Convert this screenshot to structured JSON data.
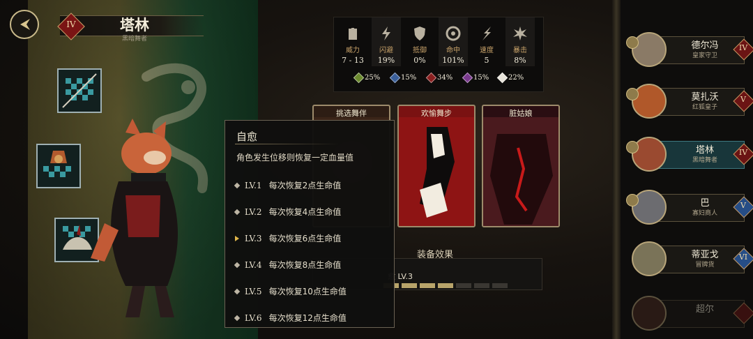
{
  "hero": {
    "name": "塔林",
    "title": "黑暗舞者",
    "rank": "IV"
  },
  "stats": [
    {
      "icon": "fist-icon",
      "label": "威力",
      "value": "7 - 13"
    },
    {
      "icon": "lightning-icon",
      "label": "闪避",
      "value": "19%"
    },
    {
      "icon": "shield-icon",
      "label": "抵御",
      "value": "0%"
    },
    {
      "icon": "target-icon",
      "label": "命中",
      "value": "101%"
    },
    {
      "icon": "speed-icon",
      "label": "速度",
      "value": "5"
    },
    {
      "icon": "crit-icon",
      "label": "暴击",
      "value": "8%"
    }
  ],
  "resistances": [
    {
      "color": "#6b8a2e",
      "value": "25%"
    },
    {
      "color": "#3a5f9a",
      "value": "15%"
    },
    {
      "color": "#8a1f1f",
      "value": "34%"
    },
    {
      "color": "#7a3a8e",
      "value": "15%"
    },
    {
      "color": "#e8e4da",
      "value": "22%"
    }
  ],
  "cards": [
    {
      "title": "挑选舞伴"
    },
    {
      "title": "欢愉舞步"
    },
    {
      "title": "脏姑娘"
    }
  ],
  "equip": {
    "label": "装备效果",
    "text": "愈 LV.3",
    "filled_segments": 4,
    "total_segments": 7
  },
  "tooltip": {
    "title": "自愈",
    "description": "角色发生位移则恢复一定血量值",
    "levels": [
      {
        "lv": "LV.1",
        "text": "每次恢复2点生命值",
        "active": false
      },
      {
        "lv": "LV.2",
        "text": "每次恢复4点生命值",
        "active": false
      },
      {
        "lv": "LV.3",
        "text": "每次恢复6点生命值",
        "active": true
      },
      {
        "lv": "LV.4",
        "text": "每次恢复8点生命值",
        "active": false
      },
      {
        "lv": "LV.5",
        "text": "每次恢复10点生命值",
        "active": false
      },
      {
        "lv": "LV.6",
        "text": "每次恢复12点生命值",
        "active": false
      }
    ]
  },
  "roster": [
    {
      "name": "德尔冯",
      "title": "皇家守卫",
      "rank": "IV",
      "rank_color": "red",
      "active": false,
      "portrait_color": "#8a7a66"
    },
    {
      "name": "莫扎沃",
      "title": "红狐皇子",
      "rank": "V",
      "rank_color": "red",
      "active": false,
      "portrait_color": "#b0582a"
    },
    {
      "name": "塔林",
      "title": "黑暗舞者",
      "rank": "IV",
      "rank_color": "red",
      "active": true,
      "portrait_color": "#9a4a30"
    },
    {
      "name": "巴",
      "title": "寡妇商人",
      "rank": "V",
      "rank_color": "blue",
      "active": false,
      "portrait_color": "#6c6c70"
    },
    {
      "name": "蒂亚戈",
      "title": "冒牌货",
      "rank": "VI",
      "rank_color": "blue",
      "active": false,
      "portrait_color": "#7a7358"
    },
    {
      "name": "超尔",
      "title": "",
      "rank": "",
      "rank_color": "red",
      "active": false,
      "portrait_color": "#4a2a20"
    }
  ]
}
